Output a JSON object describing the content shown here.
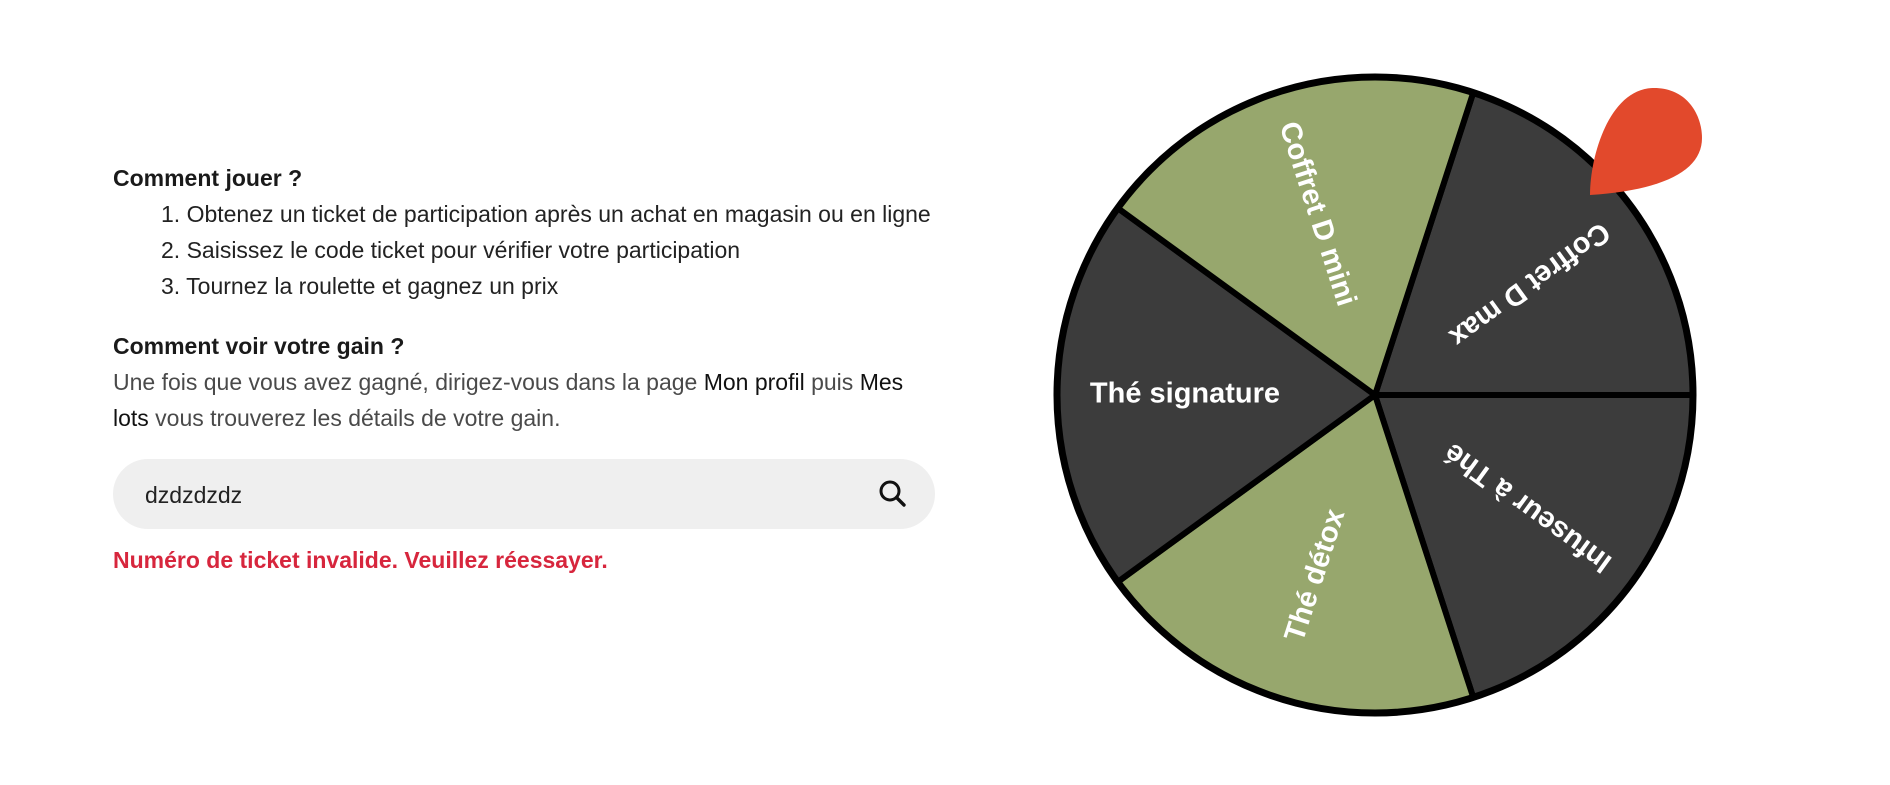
{
  "how_to_play": {
    "title": "Comment jouer ?",
    "steps": [
      "1. Obtenez un ticket de participation après un achat en magasin ou en ligne",
      "2. Saisissez le code ticket pour vérifier votre participation",
      "3. Tournez la roulette et gagnez un prix"
    ]
  },
  "how_to_see": {
    "title": "Comment voir votre gain ?",
    "text_1": "Une fois que vous avez gagné, dirigez-vous dans la page ",
    "link_profile": "Mon profil",
    "text_2": " puis ",
    "link_lots": "Mes lots",
    "text_3": " vous trouverez les détails de votre gain."
  },
  "ticket_search": {
    "value": "dzdzdzdz",
    "icon": "search-icon"
  },
  "error_message": "Numéro de ticket invalide. Veuillez réessayer.",
  "wheel": {
    "segments": [
      {
        "label": "Coffret D max",
        "color": "#3c3c3c"
      },
      {
        "label": "Infuseur à Thé",
        "color": "#3c3c3c"
      },
      {
        "label": "Thé détox",
        "color": "#97a76d"
      },
      {
        "label": "Thé signature",
        "color": "#3c3c3c"
      },
      {
        "label": "Coffret D mini",
        "color": "#97a76d"
      }
    ],
    "pointer_color": "#e2492c",
    "border_color": "#000000"
  }
}
